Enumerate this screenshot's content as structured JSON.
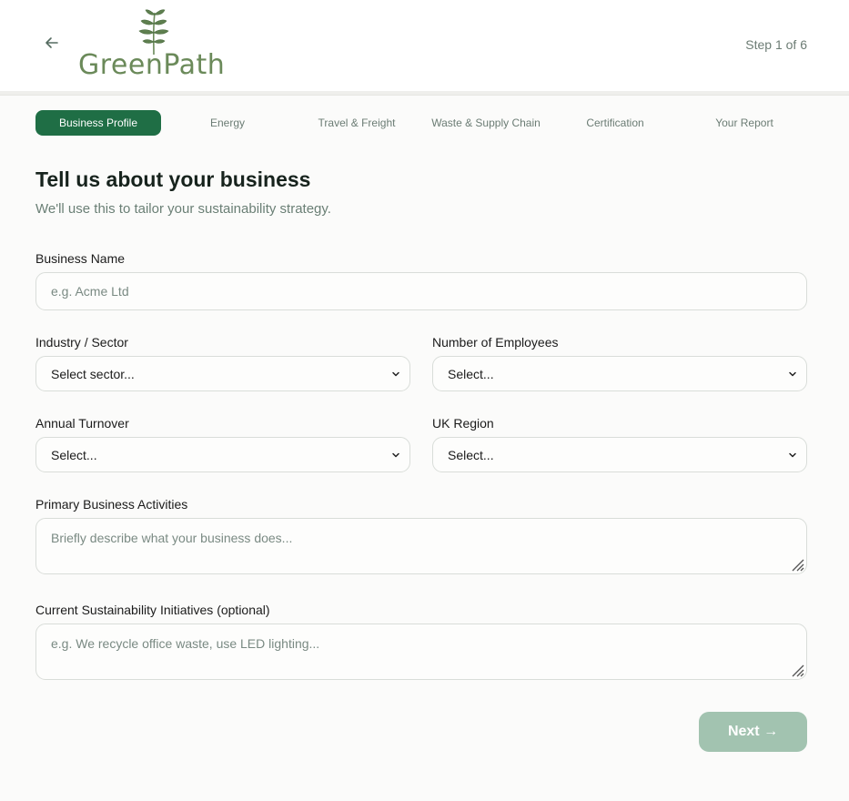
{
  "header": {
    "logo_text": "GreenPath",
    "step_counter": "Step 1 of 6"
  },
  "stepper": {
    "steps": [
      {
        "label": "Business Profile",
        "active": true
      },
      {
        "label": "Energy",
        "active": false
      },
      {
        "label": "Travel & Freight",
        "active": false
      },
      {
        "label": "Waste & Supply Chain",
        "active": false
      },
      {
        "label": "Certification",
        "active": false
      },
      {
        "label": "Your Report",
        "active": false
      }
    ]
  },
  "form": {
    "title": "Tell us about your business",
    "subtitle": "We'll use this to tailor your sustainability strategy.",
    "business_name": {
      "label": "Business Name",
      "placeholder": "e.g. Acme Ltd",
      "value": ""
    },
    "industry": {
      "label": "Industry / Sector",
      "selected": "Select sector..."
    },
    "employees": {
      "label": "Number of Employees",
      "selected": "Select..."
    },
    "turnover": {
      "label": "Annual Turnover",
      "selected": "Select..."
    },
    "region": {
      "label": "UK Region",
      "selected": "Select..."
    },
    "activities": {
      "label": "Primary Business Activities",
      "placeholder": "Briefly describe what your business does..."
    },
    "initiatives": {
      "label": "Current Sustainability Initiatives (optional)",
      "placeholder": "e.g. We recycle office waste, use LED lighting..."
    }
  },
  "actions": {
    "next_label": "Next →"
  },
  "colors": {
    "accent": "#1f6e45",
    "next_disabled": "#a2c3b0",
    "logo": "#6b8a5a"
  },
  "icons": {
    "back": "arrow-left-icon",
    "select": "chevron-down-icon",
    "resize": "resize-grip-icon",
    "logo": "leaf-sprig-icon"
  }
}
